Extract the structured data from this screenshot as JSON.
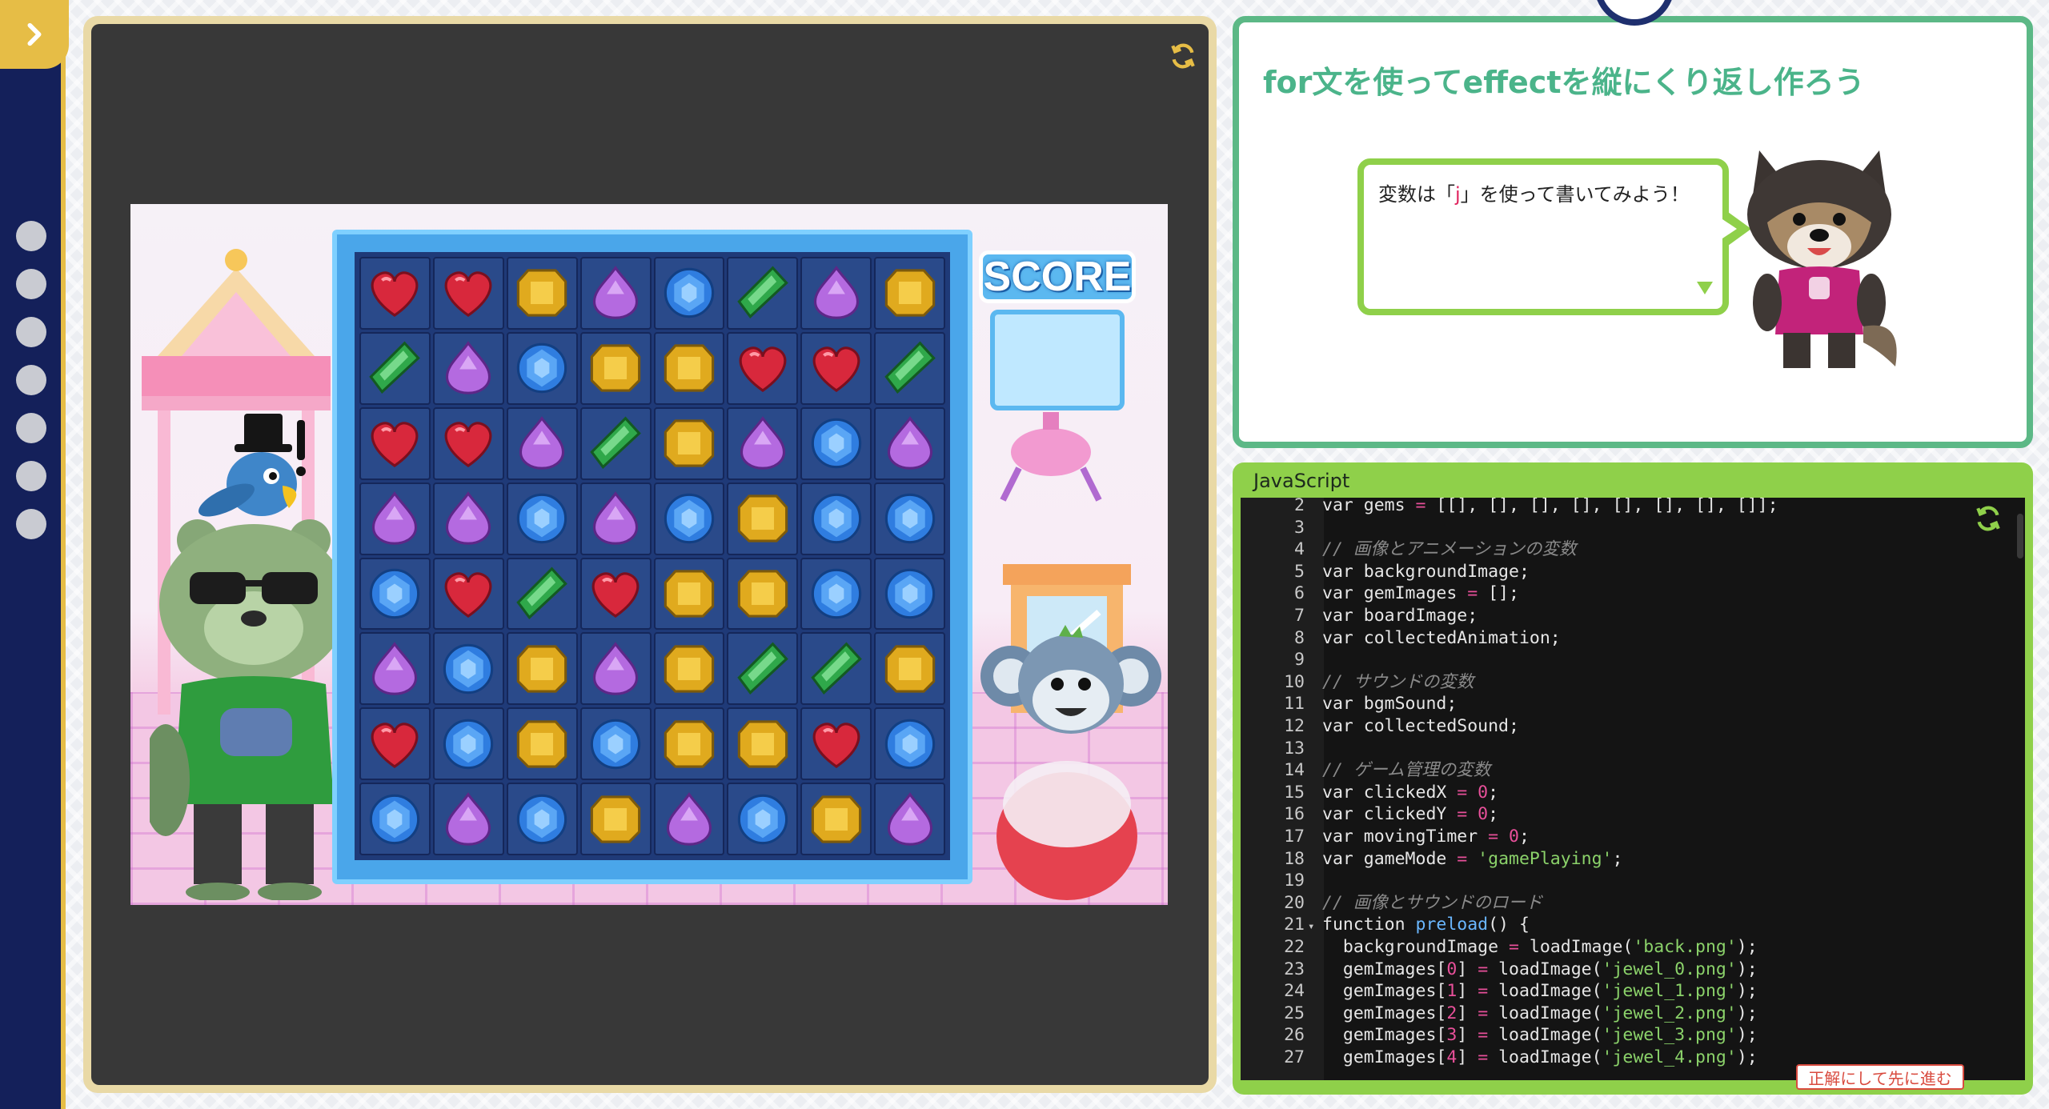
{
  "sidebar": {
    "toggle_icon": "chevron-right-icon",
    "step_count": 7,
    "accent_color": "#e6bd46",
    "background_color": "#14205a"
  },
  "stage": {
    "reload_icon": "reload-icon",
    "score_label": "SCORE",
    "board": [
      [
        "heart",
        "heart",
        "topaz",
        "amethyst",
        "sapphire",
        "emerald",
        "amethyst",
        "topaz"
      ],
      [
        "emerald",
        "amethyst",
        "sapphire",
        "topaz",
        "topaz",
        "heart",
        "heart",
        "emerald"
      ],
      [
        "heart",
        "heart",
        "amethyst",
        "emerald",
        "topaz",
        "amethyst",
        "sapphire",
        "amethyst"
      ],
      [
        "amethyst",
        "amethyst",
        "sapphire",
        "amethyst",
        "sapphire",
        "topaz",
        "sapphire",
        "sapphire"
      ],
      [
        "sapphire",
        "heart",
        "emerald",
        "heart",
        "topaz",
        "topaz",
        "sapphire",
        "sapphire"
      ],
      [
        "amethyst",
        "sapphire",
        "topaz",
        "amethyst",
        "topaz",
        "emerald",
        "emerald",
        "topaz"
      ],
      [
        "heart",
        "sapphire",
        "topaz",
        "sapphire",
        "topaz",
        "topaz",
        "heart",
        "sapphire"
      ],
      [
        "sapphire",
        "amethyst",
        "sapphire",
        "topaz",
        "amethyst",
        "sapphire",
        "topaz",
        "amethyst"
      ]
    ]
  },
  "mission": {
    "title": "for文を使ってeffectを縦にくり返し作ろう",
    "hint_before": "変数は「",
    "hint_var": "j",
    "hint_after": "」を使って書いてみよう！",
    "border_color": "#5cb886"
  },
  "code_panel": {
    "language_label": "JavaScript",
    "reload_icon": "reload-icon",
    "answer_button_label": "正解にして先に進む",
    "lines": [
      {
        "n": "2",
        "fold": "",
        "segs": [
          [
            "kw",
            "var gems "
          ],
          [
            "op",
            "="
          ],
          [
            "kw",
            " [[], [], [], [], [], [], [], []];"
          ]
        ]
      },
      {
        "n": "3",
        "fold": "",
        "segs": []
      },
      {
        "n": "4",
        "fold": "",
        "segs": [
          [
            "cm",
            "// 画像とアニメーションの変数"
          ]
        ]
      },
      {
        "n": "5",
        "fold": "",
        "segs": [
          [
            "kw",
            "var backgroundImage;"
          ]
        ]
      },
      {
        "n": "6",
        "fold": "",
        "segs": [
          [
            "kw",
            "var gemImages "
          ],
          [
            "op",
            "="
          ],
          [
            "kw",
            " [];"
          ]
        ]
      },
      {
        "n": "7",
        "fold": "",
        "segs": [
          [
            "kw",
            "var boardImage;"
          ]
        ]
      },
      {
        "n": "8",
        "fold": "",
        "segs": [
          [
            "kw",
            "var collectedAnimation;"
          ]
        ]
      },
      {
        "n": "9",
        "fold": "",
        "segs": []
      },
      {
        "n": "10",
        "fold": "",
        "segs": [
          [
            "cm",
            "// サウンドの変数"
          ]
        ]
      },
      {
        "n": "11",
        "fold": "",
        "segs": [
          [
            "kw",
            "var bgmSound;"
          ]
        ]
      },
      {
        "n": "12",
        "fold": "",
        "segs": [
          [
            "kw",
            "var collectedSound;"
          ]
        ]
      },
      {
        "n": "13",
        "fold": "",
        "segs": []
      },
      {
        "n": "14",
        "fold": "",
        "segs": [
          [
            "cm",
            "// ゲーム管理の変数"
          ]
        ]
      },
      {
        "n": "15",
        "fold": "",
        "segs": [
          [
            "kw",
            "var clickedX "
          ],
          [
            "op",
            "="
          ],
          [
            "num",
            " 0"
          ],
          [
            "kw",
            ";"
          ]
        ]
      },
      {
        "n": "16",
        "fold": "",
        "segs": [
          [
            "kw",
            "var clickedY "
          ],
          [
            "op",
            "="
          ],
          [
            "num",
            " 0"
          ],
          [
            "kw",
            ";"
          ]
        ]
      },
      {
        "n": "17",
        "fold": "",
        "segs": [
          [
            "kw",
            "var movingTimer "
          ],
          [
            "op",
            "="
          ],
          [
            "num",
            " 0"
          ],
          [
            "kw",
            ";"
          ]
        ]
      },
      {
        "n": "18",
        "fold": "",
        "segs": [
          [
            "kw",
            "var gameMode "
          ],
          [
            "op",
            "="
          ],
          [
            "str",
            " 'gamePlaying'"
          ],
          [
            "kw",
            ";"
          ]
        ]
      },
      {
        "n": "19",
        "fold": "",
        "segs": []
      },
      {
        "n": "20",
        "fold": "",
        "segs": [
          [
            "cm",
            "// 画像とサウンドのロード"
          ]
        ]
      },
      {
        "n": "21",
        "fold": "▾",
        "segs": [
          [
            "kw",
            "function "
          ],
          [
            "fn",
            "preload"
          ],
          [
            "kw",
            "() {"
          ]
        ]
      },
      {
        "n": "22",
        "fold": "",
        "segs": [
          [
            "kw",
            "  backgroundImage "
          ],
          [
            "op",
            "="
          ],
          [
            "kw",
            " loadImage("
          ],
          [
            "str",
            "'back.png'"
          ],
          [
            "kw",
            ");"
          ]
        ]
      },
      {
        "n": "23",
        "fold": "",
        "segs": [
          [
            "kw",
            "  gemImages["
          ],
          [
            "num",
            "0"
          ],
          [
            "kw",
            "] "
          ],
          [
            "op",
            "="
          ],
          [
            "kw",
            " loadImage("
          ],
          [
            "str",
            "'jewel_0.png'"
          ],
          [
            "kw",
            ");"
          ]
        ]
      },
      {
        "n": "24",
        "fold": "",
        "segs": [
          [
            "kw",
            "  gemImages["
          ],
          [
            "num",
            "1"
          ],
          [
            "kw",
            "] "
          ],
          [
            "op",
            "="
          ],
          [
            "kw",
            " loadImage("
          ],
          [
            "str",
            "'jewel_1.png'"
          ],
          [
            "kw",
            ");"
          ]
        ]
      },
      {
        "n": "25",
        "fold": "",
        "segs": [
          [
            "kw",
            "  gemImages["
          ],
          [
            "num",
            "2"
          ],
          [
            "kw",
            "] "
          ],
          [
            "op",
            "="
          ],
          [
            "kw",
            " loadImage("
          ],
          [
            "str",
            "'jewel_2.png'"
          ],
          [
            "kw",
            ");"
          ]
        ]
      },
      {
        "n": "26",
        "fold": "",
        "segs": [
          [
            "kw",
            "  gemImages["
          ],
          [
            "num",
            "3"
          ],
          [
            "kw",
            "] "
          ],
          [
            "op",
            "="
          ],
          [
            "kw",
            " loadImage("
          ],
          [
            "str",
            "'jewel_3.png'"
          ],
          [
            "kw",
            ");"
          ]
        ]
      },
      {
        "n": "27",
        "fold": "",
        "segs": [
          [
            "kw",
            "  gemImages["
          ],
          [
            "num",
            "4"
          ],
          [
            "kw",
            "] "
          ],
          [
            "op",
            "="
          ],
          [
            "kw",
            " loadImage("
          ],
          [
            "str",
            "'jewel_4.png'"
          ],
          [
            "kw",
            ");"
          ]
        ]
      }
    ]
  }
}
